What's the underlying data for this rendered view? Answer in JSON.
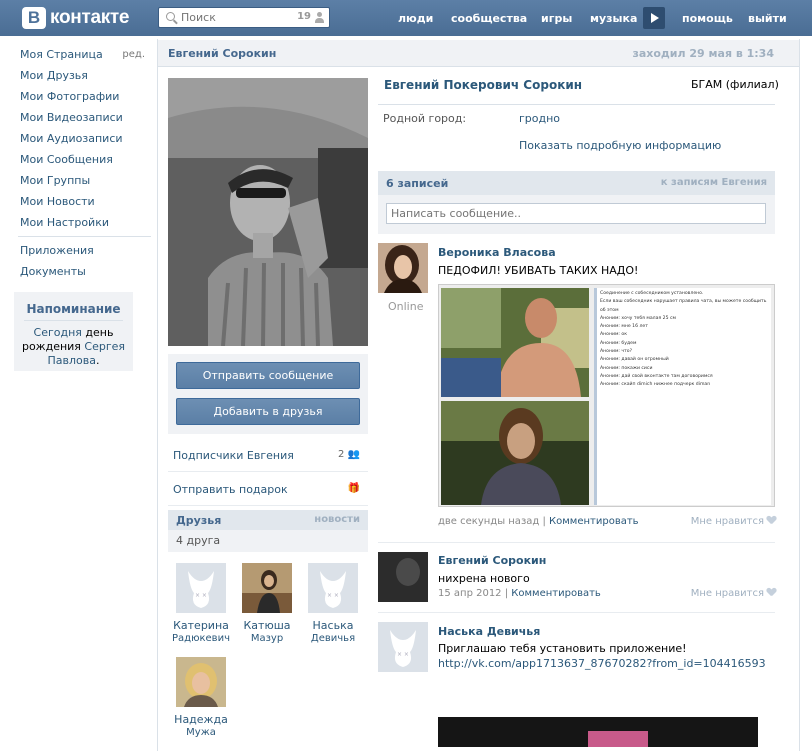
{
  "header": {
    "logo_letter": "В",
    "logo_text": "контакте",
    "search_placeholder": "Поиск",
    "search_count": "19",
    "nav": [
      "люди",
      "сообщества",
      "игры",
      "музыка",
      "помощь",
      "выйти"
    ]
  },
  "sidebar": {
    "items": [
      "Моя Страница",
      "Мои Друзья",
      "Мои Фотографии",
      "Мои Видеозаписи",
      "Мои Аудиозаписи",
      "Мои Сообщения",
      "Мои Группы",
      "Мои Новости",
      "Мои Настройки"
    ],
    "edit": "ред.",
    "items2": [
      "Приложения",
      "Документы"
    ]
  },
  "reminder": {
    "title": "Напоминание",
    "w1": "Сегодня",
    "w2": " день рождения ",
    "name1": "Сергея",
    "name2": "Павлова",
    "dot": "."
  },
  "profile": {
    "short_name": "Евгений Сорокин",
    "last_seen": "заходил 29 мая в 1:34",
    "full_name": "Евгений Покерович Сорокин",
    "university": "БГАМ (филиал)",
    "home_label": "Родной город:",
    "home_value": "гродно",
    "more_info": "Показать подробную информацию"
  },
  "actions": {
    "send_message": "Отправить сообщение",
    "add_friend": "Добавить в друзья",
    "followers": "Подписчики Евгения",
    "followers_count": "2",
    "gift": "Отправить подарок"
  },
  "friends": {
    "title": "Друзья",
    "news": "новости",
    "count": "4 друга",
    "list": [
      {
        "first": "Катерина",
        "last": "Радюкевич"
      },
      {
        "first": "Катюша",
        "last": "Мазур"
      },
      {
        "first": "Наська",
        "last": "Девичья"
      },
      {
        "first": "Надежда",
        "last": "Мужа"
      }
    ]
  },
  "wall": {
    "count": "6 записей",
    "link": "к записям Евгения",
    "input_placeholder": "Написать сообщение..",
    "posts": [
      {
        "author": "Вероника Власова",
        "text": "ПЕДОФИЛ! УБИВАТЬ ТАКИХ НАДО!",
        "status": "Online",
        "time": "две секунды назад",
        "comment": "Комментировать",
        "like": "Мне нравится"
      },
      {
        "author": "Евгений Сорокин",
        "text": "нихрена нового",
        "time": "15 апр 2012",
        "comment": "Комментировать",
        "like": "Мне нравится"
      },
      {
        "author": "Наська Девичья",
        "text": "Приглашаю тебя установить приложение!",
        "link": "http://vk.com/app1713637_87670282?from_id=104416593"
      }
    ],
    "chat": {
      "lines": [
        "Соединение с собеседником установлено.",
        "Если ваш собеседник нарушает правила чата, вы можете сообщить об этом",
        "Аноним: хочу тебя малая 25 см",
        "Аноним: мне 16 лет",
        "Аноним: ок",
        "Аноним: будем",
        "Аноним: что?",
        "Аноним: давай он огромный",
        "Аноним: покажи сиси",
        "Аноним: дай свой вконтакте там договоримся",
        "Аноним: скайп dimich нижнее подчерк diman"
      ]
    }
  }
}
